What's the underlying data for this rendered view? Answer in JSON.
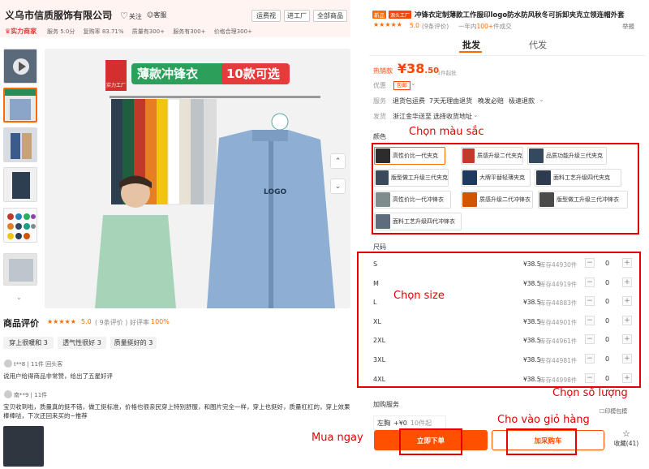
{
  "shop": {
    "name": "义乌市信质服饰有限公司",
    "follow": "关注",
    "collect": "客服",
    "btn_contact": "运费视",
    "btn_factory": "进工厂",
    "btn_all": "全部商品",
    "badge": "实力商家",
    "stats": [
      "服务 5.0分",
      "复购率 83.71%",
      "质量有300+",
      "服务有300+",
      "价格合理300+"
    ]
  },
  "main_image": {
    "banner": "薄款冲锋衣",
    "banner_right": "10款可选",
    "badge": "实力工厂",
    "logo_text": "LOGO"
  },
  "reviews": {
    "title": "商品评价",
    "score": "5.0",
    "count": "( 9条评价 )",
    "good_label": "好评率",
    "good_rate": "100%",
    "tags": [
      "穿上很暖和 3",
      "透气性很好 3",
      "质量挺好的 3"
    ],
    "items": [
      {
        "user": "t**8 | 11件 回头客",
        "text": "说用户给得商品非常赞，给出了五星好评"
      },
      {
        "user": "南**9 | 11件",
        "text": "宝贝收到啦，质量真的挺不错，做工挺标准，价格也很亲民穿上特别舒服，和图片完全一样，穿上也挺好，质量杠杠的，穿上效果棒棒哒，下次还回来买的~推荐"
      }
    ]
  },
  "product": {
    "tag_new": "新品",
    "tag_src": "源头工厂",
    "title": "冲锋衣定制薄款工作服印logo防水防风秋冬可拆卸夹克立领连帽外套",
    "score": "5.0",
    "reviews": "9条评价",
    "sales_prefix": "一年内",
    "sales_value": "100+",
    "sales_suffix": "件成交",
    "report": "举报"
  },
  "tabs": {
    "wholesale": "批发",
    "dropship": "代发"
  },
  "price": {
    "label": "热销款",
    "currency": "¥",
    "main": "38",
    "decimal": ".50",
    "unit": "1件起批"
  },
  "offers": {
    "label": "优惠",
    "coupon": "包邮"
  },
  "services": {
    "label": "服务",
    "items": [
      "退货包运费",
      "7天无理由退货",
      "晚发必赔",
      "极速退款"
    ]
  },
  "shipping": {
    "label": "发货",
    "from": "浙江金华",
    "method": "送至",
    "detail": "选择收货地址"
  },
  "colors": {
    "label": "颜色",
    "options": [
      {
        "name": "高性价比一代夹克",
        "swatch": "#2c2c2c"
      },
      {
        "name": "质感升级二代夹克",
        "swatch": "#c0392b"
      },
      {
        "name": "品质功能升级三代夹克",
        "swatch": "#34495e"
      },
      {
        "name": "版型做工升级三代夹克",
        "swatch": "#3b4a5a"
      },
      {
        "name": "大牌平替轻薄夹克",
        "swatch": "#1f3a5f"
      },
      {
        "name": "面料工艺升级四代夹克",
        "swatch": "#2e3b4e"
      },
      {
        "name": "高性价比一代冲锋衣",
        "swatch": "#7f8c8d"
      },
      {
        "name": "质感升级二代冲锋衣",
        "swatch": "#d35400"
      },
      {
        "name": "版型做工升级三代冲锋衣",
        "swatch": "#4a4a4a"
      },
      {
        "name": "面料工艺升级四代冲锋衣",
        "swatch": "#5d6d7e"
      }
    ]
  },
  "sizes": {
    "label": "尺码",
    "rows": [
      {
        "name": "S",
        "price": "¥38.5",
        "stock": "库存44930件",
        "qty": "0"
      },
      {
        "name": "M",
        "price": "¥38.5",
        "stock": "库存44919件",
        "qty": "0"
      },
      {
        "name": "L",
        "price": "¥38.5",
        "stock": "库存44883件",
        "qty": "0"
      },
      {
        "name": "XL",
        "price": "¥38.5",
        "stock": "库存44901件",
        "qty": "0"
      },
      {
        "name": "2XL",
        "price": "¥38.5",
        "stock": "库存44961件",
        "qty": "0"
      },
      {
        "name": "3XL",
        "price": "¥38.5",
        "stock": "库存44981件",
        "qty": "0"
      },
      {
        "name": "4XL",
        "price": "¥38.5",
        "stock": "库存44998件",
        "qty": "0"
      }
    ],
    "minus": "−",
    "plus": "+"
  },
  "addon": {
    "label": "加购服务",
    "name": "左胸",
    "price": "+¥0",
    "min": "10件起"
  },
  "actions": {
    "buy": "立即下单",
    "cart": "加采购车",
    "fav_label": "收藏",
    "fav_count": "(41)",
    "print": "印模包模"
  },
  "annotations": {
    "color": "Chọn màu sắc",
    "size": "Chọn size",
    "qty": "Chọn số lượng",
    "cart": "Cho vào giỏ hàng",
    "buy": "Mua ngay"
  },
  "colors_theme": {
    "accent": "#ff6a00",
    "price": "#ff4400",
    "annotation": "#e60000"
  }
}
